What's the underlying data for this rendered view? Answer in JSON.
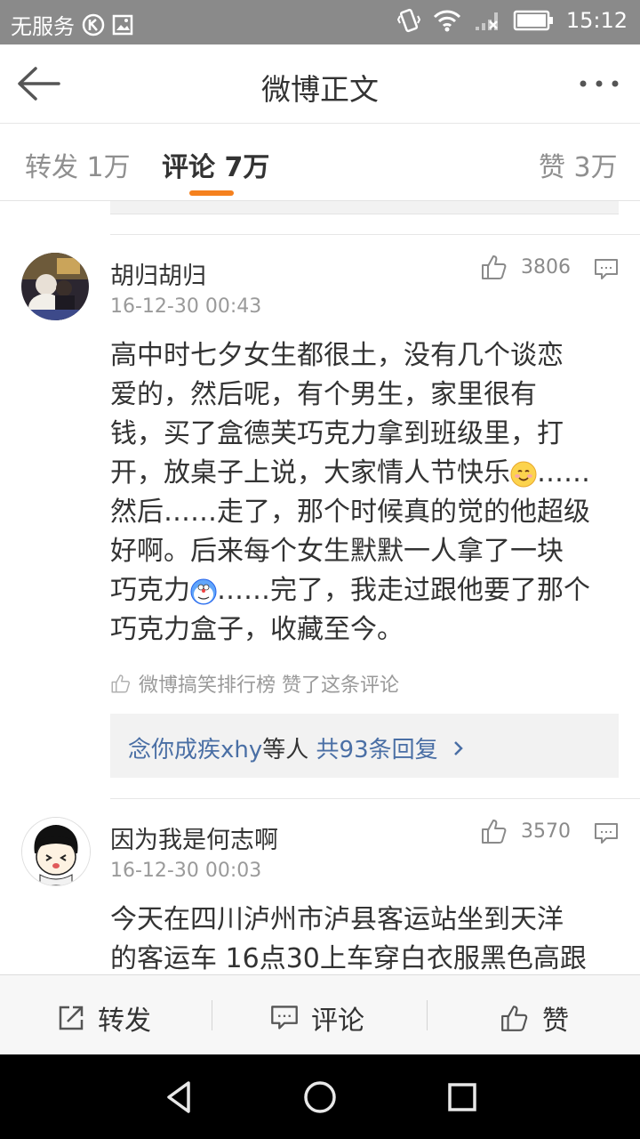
{
  "status_bar": {
    "carrier": "无服务",
    "time": "15:12",
    "icons": [
      "k-circle-icon",
      "image-icon",
      "vibrate-icon",
      "wifi-icon",
      "signal-icon",
      "battery-icon"
    ]
  },
  "header": {
    "title": "微博正文",
    "back_icon": "back-arrow-icon",
    "more_icon": "more-dots-icon"
  },
  "tabs": {
    "repost": "转发 1万",
    "comments": "评论 7万",
    "likes": "赞 3万",
    "active": "comments",
    "accent_color": "#f5811e"
  },
  "comments": [
    {
      "name": "胡归胡归",
      "time": "16-12-30 00:43",
      "likes": "3806",
      "text_lines": [
        "高中时七夕女生都很土，没有几个谈恋",
        "爱的，然后呢，有个男生，家里很有",
        "钱，买了盒德芙巧克力拿到班级里，打",
        "开，放桌子上说，大家情人节快乐",
        "……",
        "然后……走了，那个时候真的觉的他超级",
        "好啊。后来每个女生默默一人拿了一块",
        "巧克力",
        "……完了，我走过跟他要了那个",
        "巧克力盒子，收藏至今。"
      ],
      "liked_by": "微博搞笑排行榜 赞了这条评论",
      "reply_prefix": "念你成疾xhy",
      "reply_mid": "等人",
      "reply_count": "共93条回复"
    },
    {
      "name": "因为我是何志啊",
      "time": "16-12-30 00:03",
      "likes": "3570",
      "text_lines": [
        "今天在四川泸州市泸县客运站坐到天洋",
        "的客运车 16点30上车穿白衣服黑色高跟"
      ]
    }
  ],
  "bottom_bar": {
    "repost": "转发",
    "comment": "评论",
    "like": "赞"
  },
  "nav": {
    "back_icon": "triangle-back-icon",
    "home_icon": "circle-home-icon",
    "recents_icon": "square-recents-icon"
  }
}
